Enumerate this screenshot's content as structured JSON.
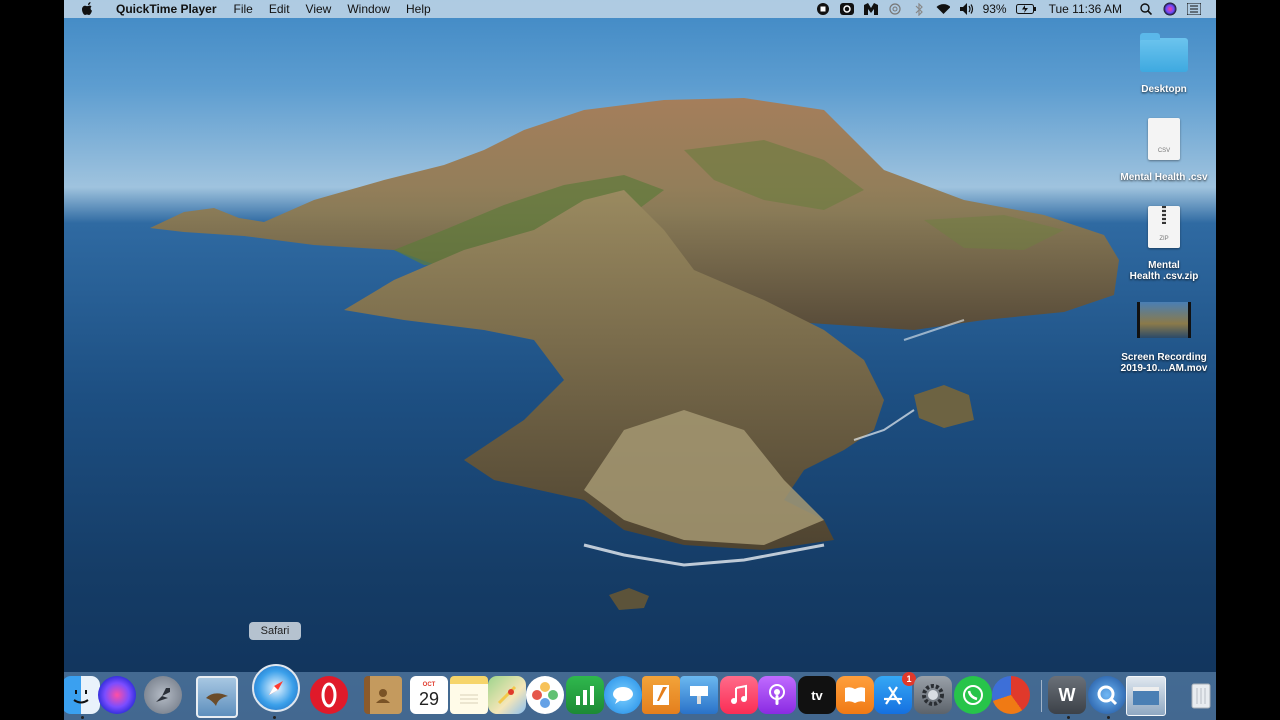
{
  "menubar": {
    "app_name": "QuickTime Player",
    "items": [
      "File",
      "Edit",
      "View",
      "Window",
      "Help"
    ],
    "battery": "93%",
    "clock": "Tue 11:36 AM"
  },
  "desktop": {
    "icons": [
      {
        "label": "Desktopn",
        "type": "folder"
      },
      {
        "label": "Mental Health .csv",
        "type": "csv",
        "tag": "CSV"
      },
      {
        "label_line1": "Mental",
        "label_line2": "Health .csv.zip",
        "type": "zip",
        "tag": "ZIP"
      },
      {
        "label_line1": "Screen Recording",
        "label_line2": "2019-10....AM.mov",
        "type": "video"
      }
    ]
  },
  "dock": {
    "tooltip": "Safari",
    "calendar_month": "OCT",
    "calendar_day": "29",
    "tv_label": "tv",
    "appstore_badge": "1",
    "w_label": "W"
  },
  "colors": {
    "sky": "#5d9dd0",
    "ocean": "#1d4f82",
    "menubar": "#bed4e6",
    "dock": "#6e96be"
  }
}
